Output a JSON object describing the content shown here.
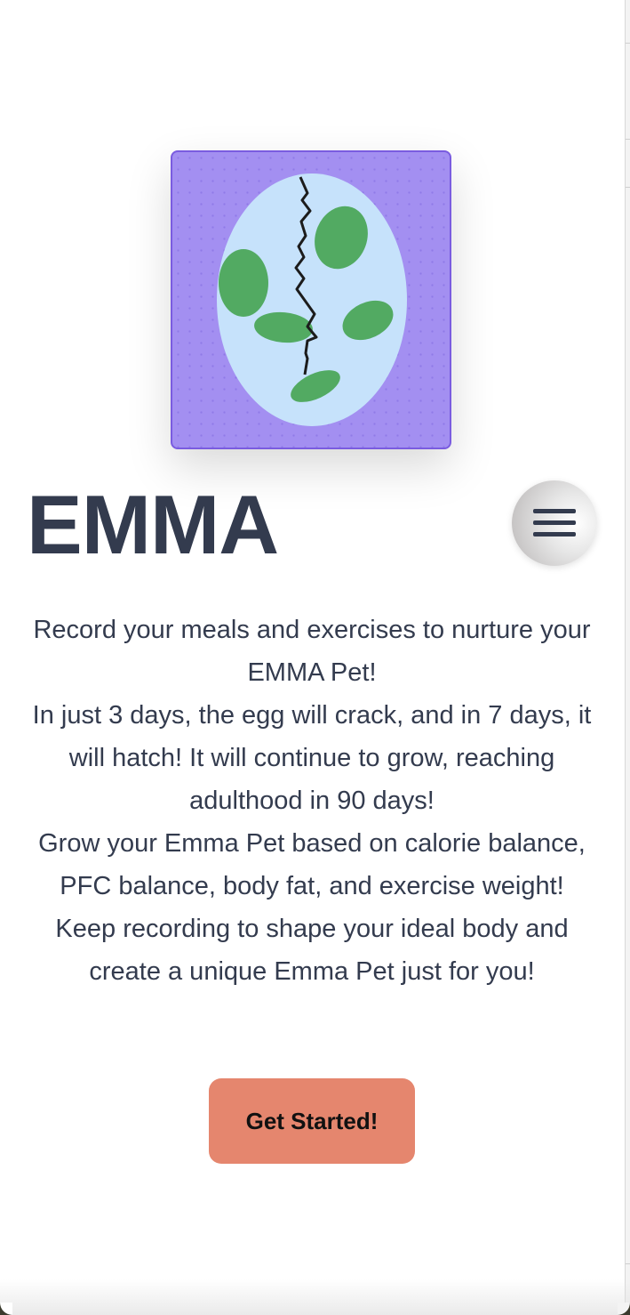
{
  "app": {
    "title": "EMMA"
  },
  "pet_image": {
    "description_icon": "cracked-egg-illustration"
  },
  "menu": {
    "icon": "hamburger-menu-icon"
  },
  "intro": {
    "paragraphs": [
      "Record your meals and exercises to nurture your EMMA Pet!",
      "In just 3 days, the egg will crack, and in 7 days, it will hatch! It will continue to grow, reaching adulthood in 90 days!",
      "Grow your Emma Pet based on calorie balance, PFC balance, body fat, and exercise weight!",
      "Keep recording to shape your ideal body and create a unique Emma Pet just for you!"
    ]
  },
  "cta": {
    "label": "Get Started!"
  },
  "colors": {
    "card_background": "#a38ff1",
    "egg": "#c6e2fb",
    "egg_spots": "#52aa62",
    "title_text": "#333b4e",
    "cta_background": "#e5866e"
  }
}
